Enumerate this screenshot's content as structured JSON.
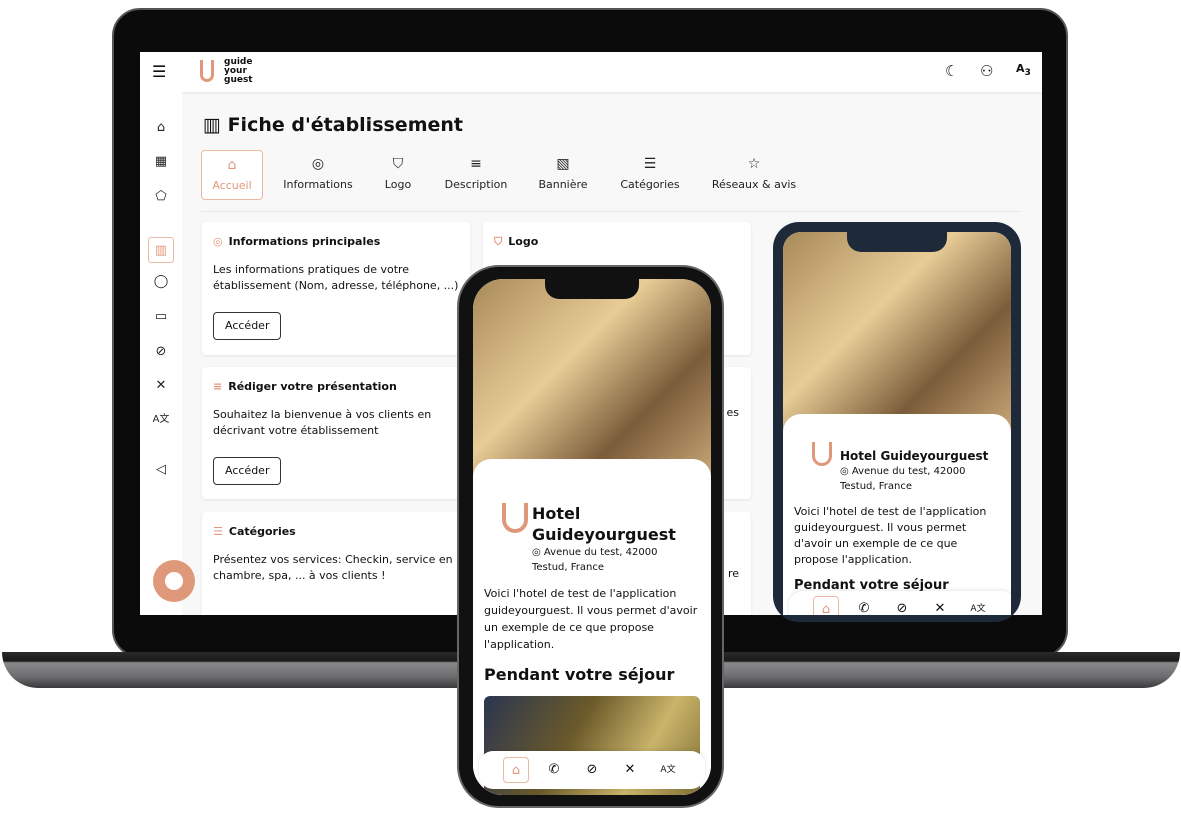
{
  "app": {
    "logo_text": "guide your guest",
    "brand_color": "#e0987a"
  },
  "topbar": {
    "icons": [
      "menu-icon",
      "moon-icon",
      "user-icon",
      "translate-icon"
    ]
  },
  "page": {
    "title": "Fiche d'établissement"
  },
  "tabs": [
    {
      "label": "Accueil",
      "icon": "home-icon"
    },
    {
      "label": "Informations",
      "icon": "pin-icon"
    },
    {
      "label": "Logo",
      "icon": "shield-icon"
    },
    {
      "label": "Description",
      "icon": "text-icon"
    },
    {
      "label": "Bannière",
      "icon": "image-icon"
    },
    {
      "label": "Catégories",
      "icon": "list-icon"
    },
    {
      "label": "Réseaux & avis",
      "icon": "star-icon"
    }
  ],
  "cards": [
    {
      "title": "Informations principales",
      "text": "Les informations pratiques de votre établissement (Nom, adresse, téléphone, ...)",
      "button": "Accéder"
    },
    {
      "title": "Logo"
    },
    {
      "title": "Rédiger votre présentation",
      "text": "Souhaitez la bienvenue à vos clients en décrivant votre établissement",
      "button": "Accéder"
    },
    {
      "title": "Catégories",
      "text": "Présentez vos services: Checkin, service en chambre, spa, ... à vos clients !"
    }
  ],
  "partial": {
    "a": "es",
    "b": "re"
  },
  "hotel": {
    "name": "Hotel Guideyourguest",
    "address": "Avenue du test, 42000 Testud, France",
    "description": "Voici l'hotel de test de l'application guideyourguest. Il vous permet d'avoir un exemple de ce que propose l'application.",
    "section": "Pendant votre séjour"
  }
}
